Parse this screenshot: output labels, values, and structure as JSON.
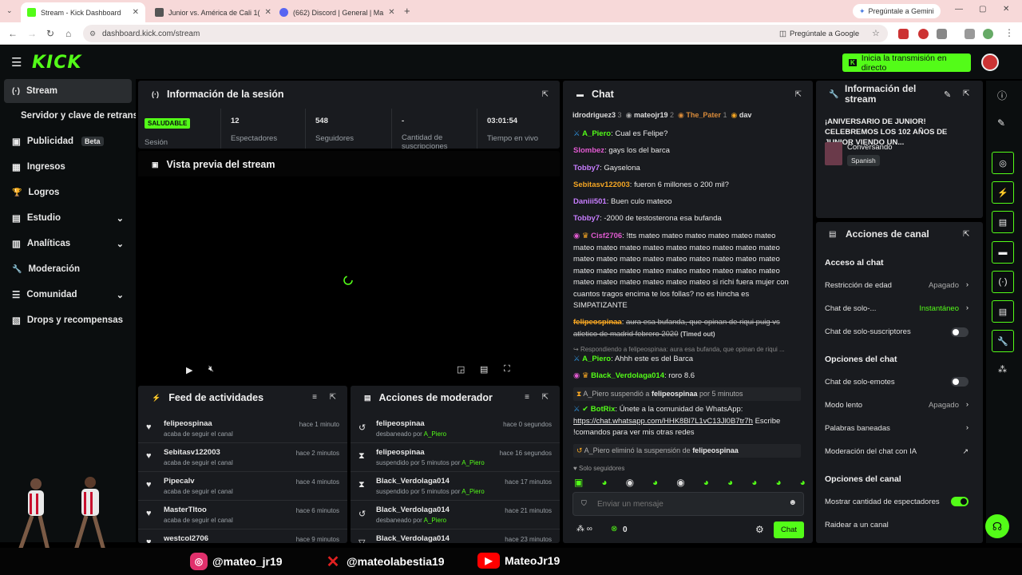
{
  "browser": {
    "tabs": [
      {
        "title": "Stream - Kick Dashboard",
        "active": true
      },
      {
        "title": "Junior vs. América de Cali 1(",
        "active": false
      },
      {
        "title": "(662) Discord | General | Ma",
        "active": false
      }
    ],
    "gemini": "Pregúntale a Gemini",
    "url": "dashboard.kick.com/stream",
    "google_prompt": "Pregúntale a Google"
  },
  "header": {
    "logo": "KICK",
    "golive": "Inicia la transmisión en directo"
  },
  "sidebar": {
    "items": [
      {
        "label": "Stream",
        "icon": "(·)",
        "chev": false
      },
      {
        "label": "Servidor y clave de retransmisión",
        "icon": "",
        "chev": false
      },
      {
        "label": "Publicidad",
        "icon": "▣",
        "chev": false,
        "badge": "Beta"
      },
      {
        "label": "Ingresos",
        "icon": "▦",
        "chev": false
      },
      {
        "label": "Logros",
        "icon": "🏆",
        "chev": false
      },
      {
        "label": "Estudio",
        "icon": "▤",
        "chev": true
      },
      {
        "label": "Analíticas",
        "icon": "▥",
        "chev": true
      },
      {
        "label": "Moderación",
        "icon": "🔧",
        "chev": false
      },
      {
        "label": "Comunidad",
        "icon": "☰",
        "chev": true
      },
      {
        "label": "Drops y recompensas",
        "icon": "▧",
        "chev": false
      }
    ]
  },
  "session": {
    "title": "Información de la sesión",
    "badge": "SALUDABLE",
    "stats": [
      {
        "value": "",
        "label": "Sesión"
      },
      {
        "value": "12",
        "label": "Espectadores"
      },
      {
        "value": "548",
        "label": "Seguidores"
      },
      {
        "value": "-",
        "label": "Cantidad de suscripciones"
      },
      {
        "value": "03:01:54",
        "label": "Tiempo en vivo"
      }
    ]
  },
  "preview": {
    "title": "Vista previa del stream"
  },
  "feed": {
    "title": "Feed de actividades",
    "rows": [
      {
        "name": "felipeospinaa",
        "sub": "acaba de seguir el canal",
        "time": "hace 1 minuto"
      },
      {
        "name": "Sebitasv122003",
        "sub": "acaba de seguir el canal",
        "time": "hace 2 minutos"
      },
      {
        "name": "Pipecalv",
        "sub": "acaba de seguir el canal",
        "time": "hace 4 minutos"
      },
      {
        "name": "MasterTItoo",
        "sub": "acaba de seguir el canal",
        "time": "hace 6 minutos"
      },
      {
        "name": "westcol2706",
        "sub": "",
        "time": "hace 9 minutos"
      }
    ]
  },
  "modactions": {
    "title": "Acciones de moderador",
    "rows": [
      {
        "name": "felipeospinaa",
        "sub": "desbaneado por",
        "by": "A_Piero",
        "time": "hace 0 segundos",
        "icon": "↺"
      },
      {
        "name": "felipeospinaa",
        "sub": "suspendido por 5 minutos por",
        "by": "A_Piero",
        "time": "hace 16 segundos",
        "icon": "⧗"
      },
      {
        "name": "Black_Verdolaga014",
        "sub": "suspendido por 5 minutos por",
        "by": "A_Piero",
        "time": "hace 17 minutos",
        "icon": "⧗"
      },
      {
        "name": "Black_Verdolaga014",
        "sub": "desbaneado por",
        "by": "A_Piero",
        "time": "hace 21 minutos",
        "icon": "↺"
      },
      {
        "name": "Black_Verdolaga014",
        "sub": "",
        "by": "",
        "time": "hace 23 minutos",
        "icon": "▽"
      }
    ]
  },
  "chat": {
    "title": "Chat",
    "top": [
      {
        "name": "idrodriguez3",
        "count": "3"
      },
      {
        "name": "mateojr19",
        "count": "2"
      },
      {
        "name": "The_Pater",
        "count": "1"
      },
      {
        "name": "dav",
        "count": "1"
      }
    ],
    "messages": [
      {
        "user": "A_Piero",
        "color": "#53fc18",
        "text": "Cual es Felipe?"
      },
      {
        "user": "Slombez",
        "color": "#e05ad0",
        "text": "gays los del barca"
      },
      {
        "user": "Tobby7",
        "color": "#c77dff",
        "text": "Gayselona"
      },
      {
        "user": "Sebitasv122003",
        "color": "#f5a623",
        "text": "fueron 6 millones o 200 mil?"
      },
      {
        "user": "Daniii501",
        "color": "#c77dff",
        "text": "Buen culo mateoo"
      },
      {
        "user": "Tobby7",
        "color": "#c77dff",
        "text": "-2000 de testosterona esa bufanda"
      },
      {
        "user": "Cisf2706",
        "color": "#e05ad0",
        "text": "!tts mateo mateo mateo mateo mateo mateo mateo mateo mateo mateo mateo mateo mateo mateo mateo mateo mateo mateo mateo mateo mateo mateo mateo mateo mateo mateo mateo mateo mateo mateo mateo mateo mateo mateo mateo mateo mateo mateo mateo si richi fuera mujer con cuantos tragos encima te los follas? no es hincha es SIMPATIZANTE"
      },
      {
        "user": "felipeospinaa",
        "color": "#f5a623",
        "text": "aura esa bufanda, que opinan de riqui puig vs atletico de madrid febrero 2020",
        "note": "(Timed out)"
      },
      {
        "user": "A_Piero",
        "color": "#53fc18",
        "text": "Ahhh este es del Barca",
        "reply": "Respondiendo a felipeospinaa: aura esa bufanda, que opinan de riqui ..."
      },
      {
        "user": "Black_Verdolaga014",
        "color": "#53fc18",
        "text": "roro 8.6"
      }
    ],
    "sys1": {
      "actor": "A_Piero",
      "mid": "suspendió a",
      "target": "felipeospinaa",
      "end": "por 5 minutos"
    },
    "botrix": {
      "user": "BotRix",
      "text": "Únete a la comunidad de WhatsApp:",
      "link": "https://chat.whatsapp.com/HHK8Bl7L1vC13Jl0B7tr7h",
      "end": "Escribe !comandos para ver mis otras redes"
    },
    "sys2": {
      "actor": "A_Piero",
      "mid": "eliminó la suspensión de",
      "target": "felipeospinaa"
    },
    "followers_only": "Solo seguidores",
    "placeholder": "Enviar un mensaje",
    "count": "0",
    "send": "Chat"
  },
  "streaminfo": {
    "title": "Información del stream",
    "desc": "¡ANIVERSARIO DE JUNIOR! CELEBREMOS LOS 102 AÑOS DE JUNIOR VIENDO UN...",
    "category": "Conversando",
    "lang": "Spanish"
  },
  "channelactions": {
    "title": "Acciones de canal",
    "sections": {
      "chat_access": "Acceso al chat",
      "chat_options": "Opciones del chat",
      "channel_options": "Opciones del canal"
    },
    "rows": {
      "age": {
        "label": "Restricción de edad",
        "value": "Apagado"
      },
      "followers": {
        "label": "Chat de solo-...",
        "value": "Instantáneo"
      },
      "subs": {
        "label": "Chat de solo-suscriptores"
      },
      "emotes": {
        "label": "Chat de solo-emotes"
      },
      "slow": {
        "label": "Modo lento",
        "value": "Apagado"
      },
      "banned": {
        "label": "Palabras baneadas"
      },
      "ai": {
        "label": "Moderación del chat con IA"
      },
      "viewers": {
        "label": "Mostrar cantidad de espectadores"
      },
      "raid": {
        "label": "Raidear a un canal"
      }
    }
  },
  "social": {
    "instagram": "@mateo_jr19",
    "x": "@mateolabestia19",
    "youtube": "MateoJr19"
  },
  "colors": {
    "brand": "#53fc18",
    "panel": "#191b1f",
    "bg": "#000000"
  }
}
